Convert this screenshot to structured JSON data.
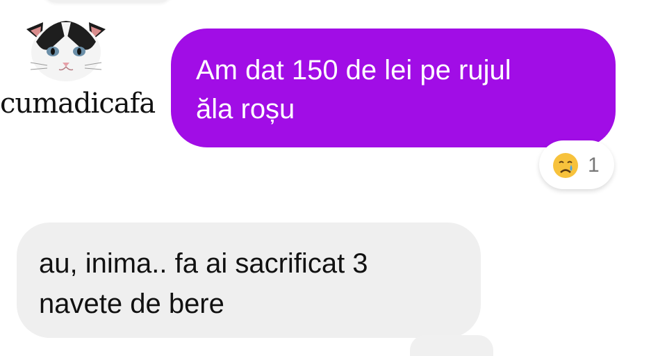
{
  "watermark": {
    "text": "cumadicafa"
  },
  "messages": [
    {
      "direction": "sent",
      "text": "Am dat 150 de lei pe rujul\năla roșu",
      "bubble_color": "#a10de6",
      "text_color": "#ffffff",
      "reaction": {
        "emoji": "crying-face-icon",
        "count": "1"
      }
    },
    {
      "direction": "received",
      "text": "au, inima.. fa ai sacrificat 3\nnavete de bere",
      "bubble_color": "#efefef",
      "text_color": "#111111"
    }
  ]
}
